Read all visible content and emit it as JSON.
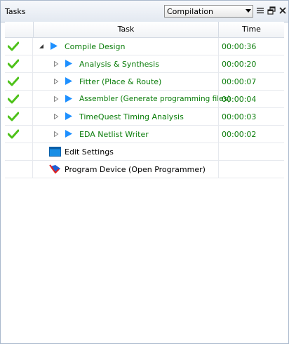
{
  "panel": {
    "title": "Tasks",
    "flow_value": "Compilation"
  },
  "columns": {
    "task": "Task",
    "time": "Time"
  },
  "colors": {
    "success": "#4ec21a",
    "task_text_done": "#0a7d0a",
    "play_icon": "#1e90ff"
  },
  "tasks": [
    {
      "label": "Compile Design",
      "time": "00:00:36",
      "status": "done",
      "level": 0,
      "expander": "expanded"
    },
    {
      "label": "Analysis & Synthesis",
      "time": "00:00:20",
      "status": "done",
      "level": 1,
      "expander": "collapsed"
    },
    {
      "label": "Fitter (Place & Route)",
      "time": "00:00:07",
      "status": "done",
      "level": 1,
      "expander": "collapsed"
    },
    {
      "label": "Assembler (Generate programming files)",
      "time": "00:00:04",
      "status": "done",
      "level": 1,
      "expander": "collapsed"
    },
    {
      "label": "TimeQuest Timing Analysis",
      "time": "00:00:03",
      "status": "done",
      "level": 1,
      "expander": "collapsed"
    },
    {
      "label": "EDA Netlist Writer",
      "time": "00:00:02",
      "status": "done",
      "level": 1,
      "expander": "collapsed"
    },
    {
      "label": "Edit Settings",
      "time": "",
      "status": "none",
      "level": 0,
      "icon": "settings-icon"
    },
    {
      "label": "Program Device (Open Programmer)",
      "time": "",
      "status": "none",
      "level": 0,
      "icon": "programmer-icon"
    }
  ]
}
